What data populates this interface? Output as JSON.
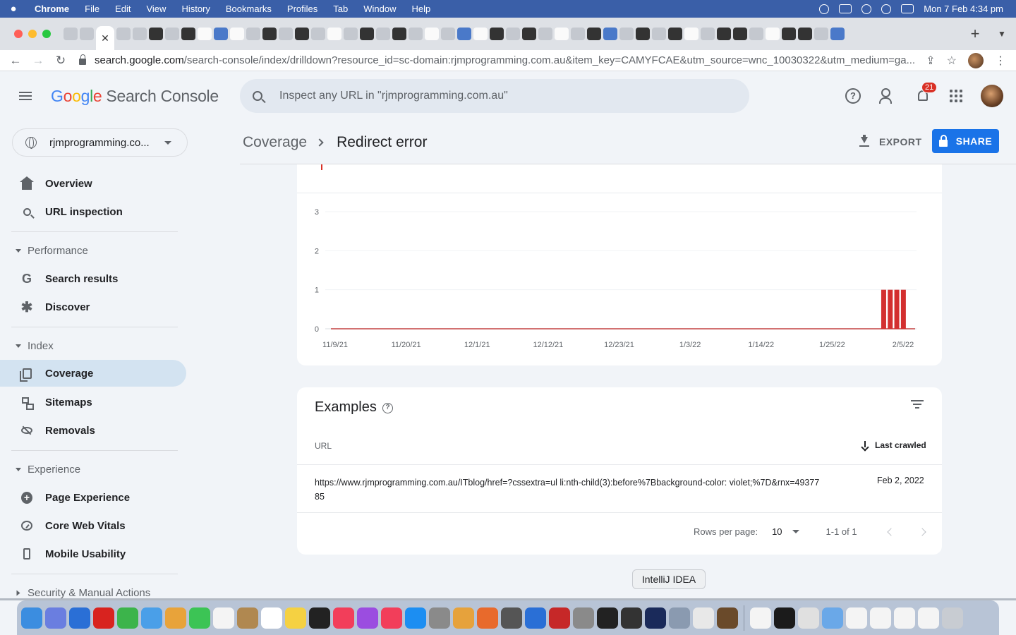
{
  "menubar": {
    "app": "Chrome",
    "items": [
      "File",
      "Edit",
      "View",
      "History",
      "Bookmarks",
      "Profiles",
      "Tab",
      "Window",
      "Help"
    ],
    "datetime": "Mon 7 Feb  4:34 pm"
  },
  "browser": {
    "active_tab_close": "✕",
    "new_tab": "+",
    "url_host": "search.google.com",
    "url_path": "/search-console/index/drilldown?resource_id=sc-domain:rjmprogramming.com.au&item_key=CAMYFCAE&utm_source=wnc_10030322&utm_medium=ga..."
  },
  "header": {
    "logo_letters": [
      "G",
      "o",
      "o",
      "g",
      "l",
      "e"
    ],
    "product": "Search Console",
    "search_placeholder": "Inspect any URL in \"rjmprogramming.com.au\"",
    "notification_count": "21"
  },
  "sidebar": {
    "property": "rjmprogramming.co...",
    "items": [
      {
        "label": "Overview",
        "icon": "home-icon"
      },
      {
        "label": "URL inspection",
        "icon": "search-icon"
      }
    ],
    "sections": [
      {
        "label": "Performance",
        "items": [
          {
            "label": "Search results",
            "icon": "google-g-icon"
          },
          {
            "label": "Discover",
            "icon": "asterisk-icon"
          }
        ]
      },
      {
        "label": "Index",
        "items": [
          {
            "label": "Coverage",
            "icon": "coverage-icon",
            "active": true
          },
          {
            "label": "Sitemaps",
            "icon": "sitemap-icon"
          },
          {
            "label": "Removals",
            "icon": "removals-icon"
          }
        ]
      },
      {
        "label": "Experience",
        "items": [
          {
            "label": "Page Experience",
            "icon": "page-experience-icon"
          },
          {
            "label": "Core Web Vitals",
            "icon": "gauge-icon"
          },
          {
            "label": "Mobile Usability",
            "icon": "phone-icon"
          }
        ]
      },
      {
        "label": "Security & Manual Actions",
        "items": []
      }
    ]
  },
  "page": {
    "breadcrumb_parent": "Coverage",
    "breadcrumb_current": "Redirect error",
    "export_label": "EXPORT",
    "share_label": "SHARE"
  },
  "chart_data": {
    "type": "bar",
    "x_ticks": [
      "11/9/21",
      "11/20/21",
      "12/1/21",
      "12/12/21",
      "12/23/21",
      "1/3/22",
      "1/14/22",
      "1/25/22",
      "2/5/22"
    ],
    "y_ticks": [
      0,
      1,
      2,
      3
    ],
    "ylim": [
      0,
      3
    ],
    "x_range": [
      "2021-11-09",
      "2022-02-07"
    ],
    "series": [
      {
        "color": "#d32f2f",
        "dates": [
          "2022-02-02",
          "2022-02-03",
          "2022-02-04",
          "2022-02-05"
        ],
        "values": [
          1,
          1,
          1,
          1
        ]
      }
    ],
    "baseline_value": 0,
    "grid": true
  },
  "examples": {
    "title": "Examples",
    "col_url": "URL",
    "col_last_crawled": "Last crawled",
    "rows": [
      {
        "url": "https://www.rjmprogramming.com.au/ITblog/href=?cssextra=ul li:nth-child(3):before%7Bbackground-color: violet;%7D&rnx=4937785",
        "last_crawled": "Feb 2, 2022"
      }
    ],
    "rows_per_page_label": "Rows per page:",
    "rows_per_page_value": "10",
    "range_label": "1-1 of 1"
  },
  "dock": {
    "tooltip": "IntelliJ IDEA"
  }
}
